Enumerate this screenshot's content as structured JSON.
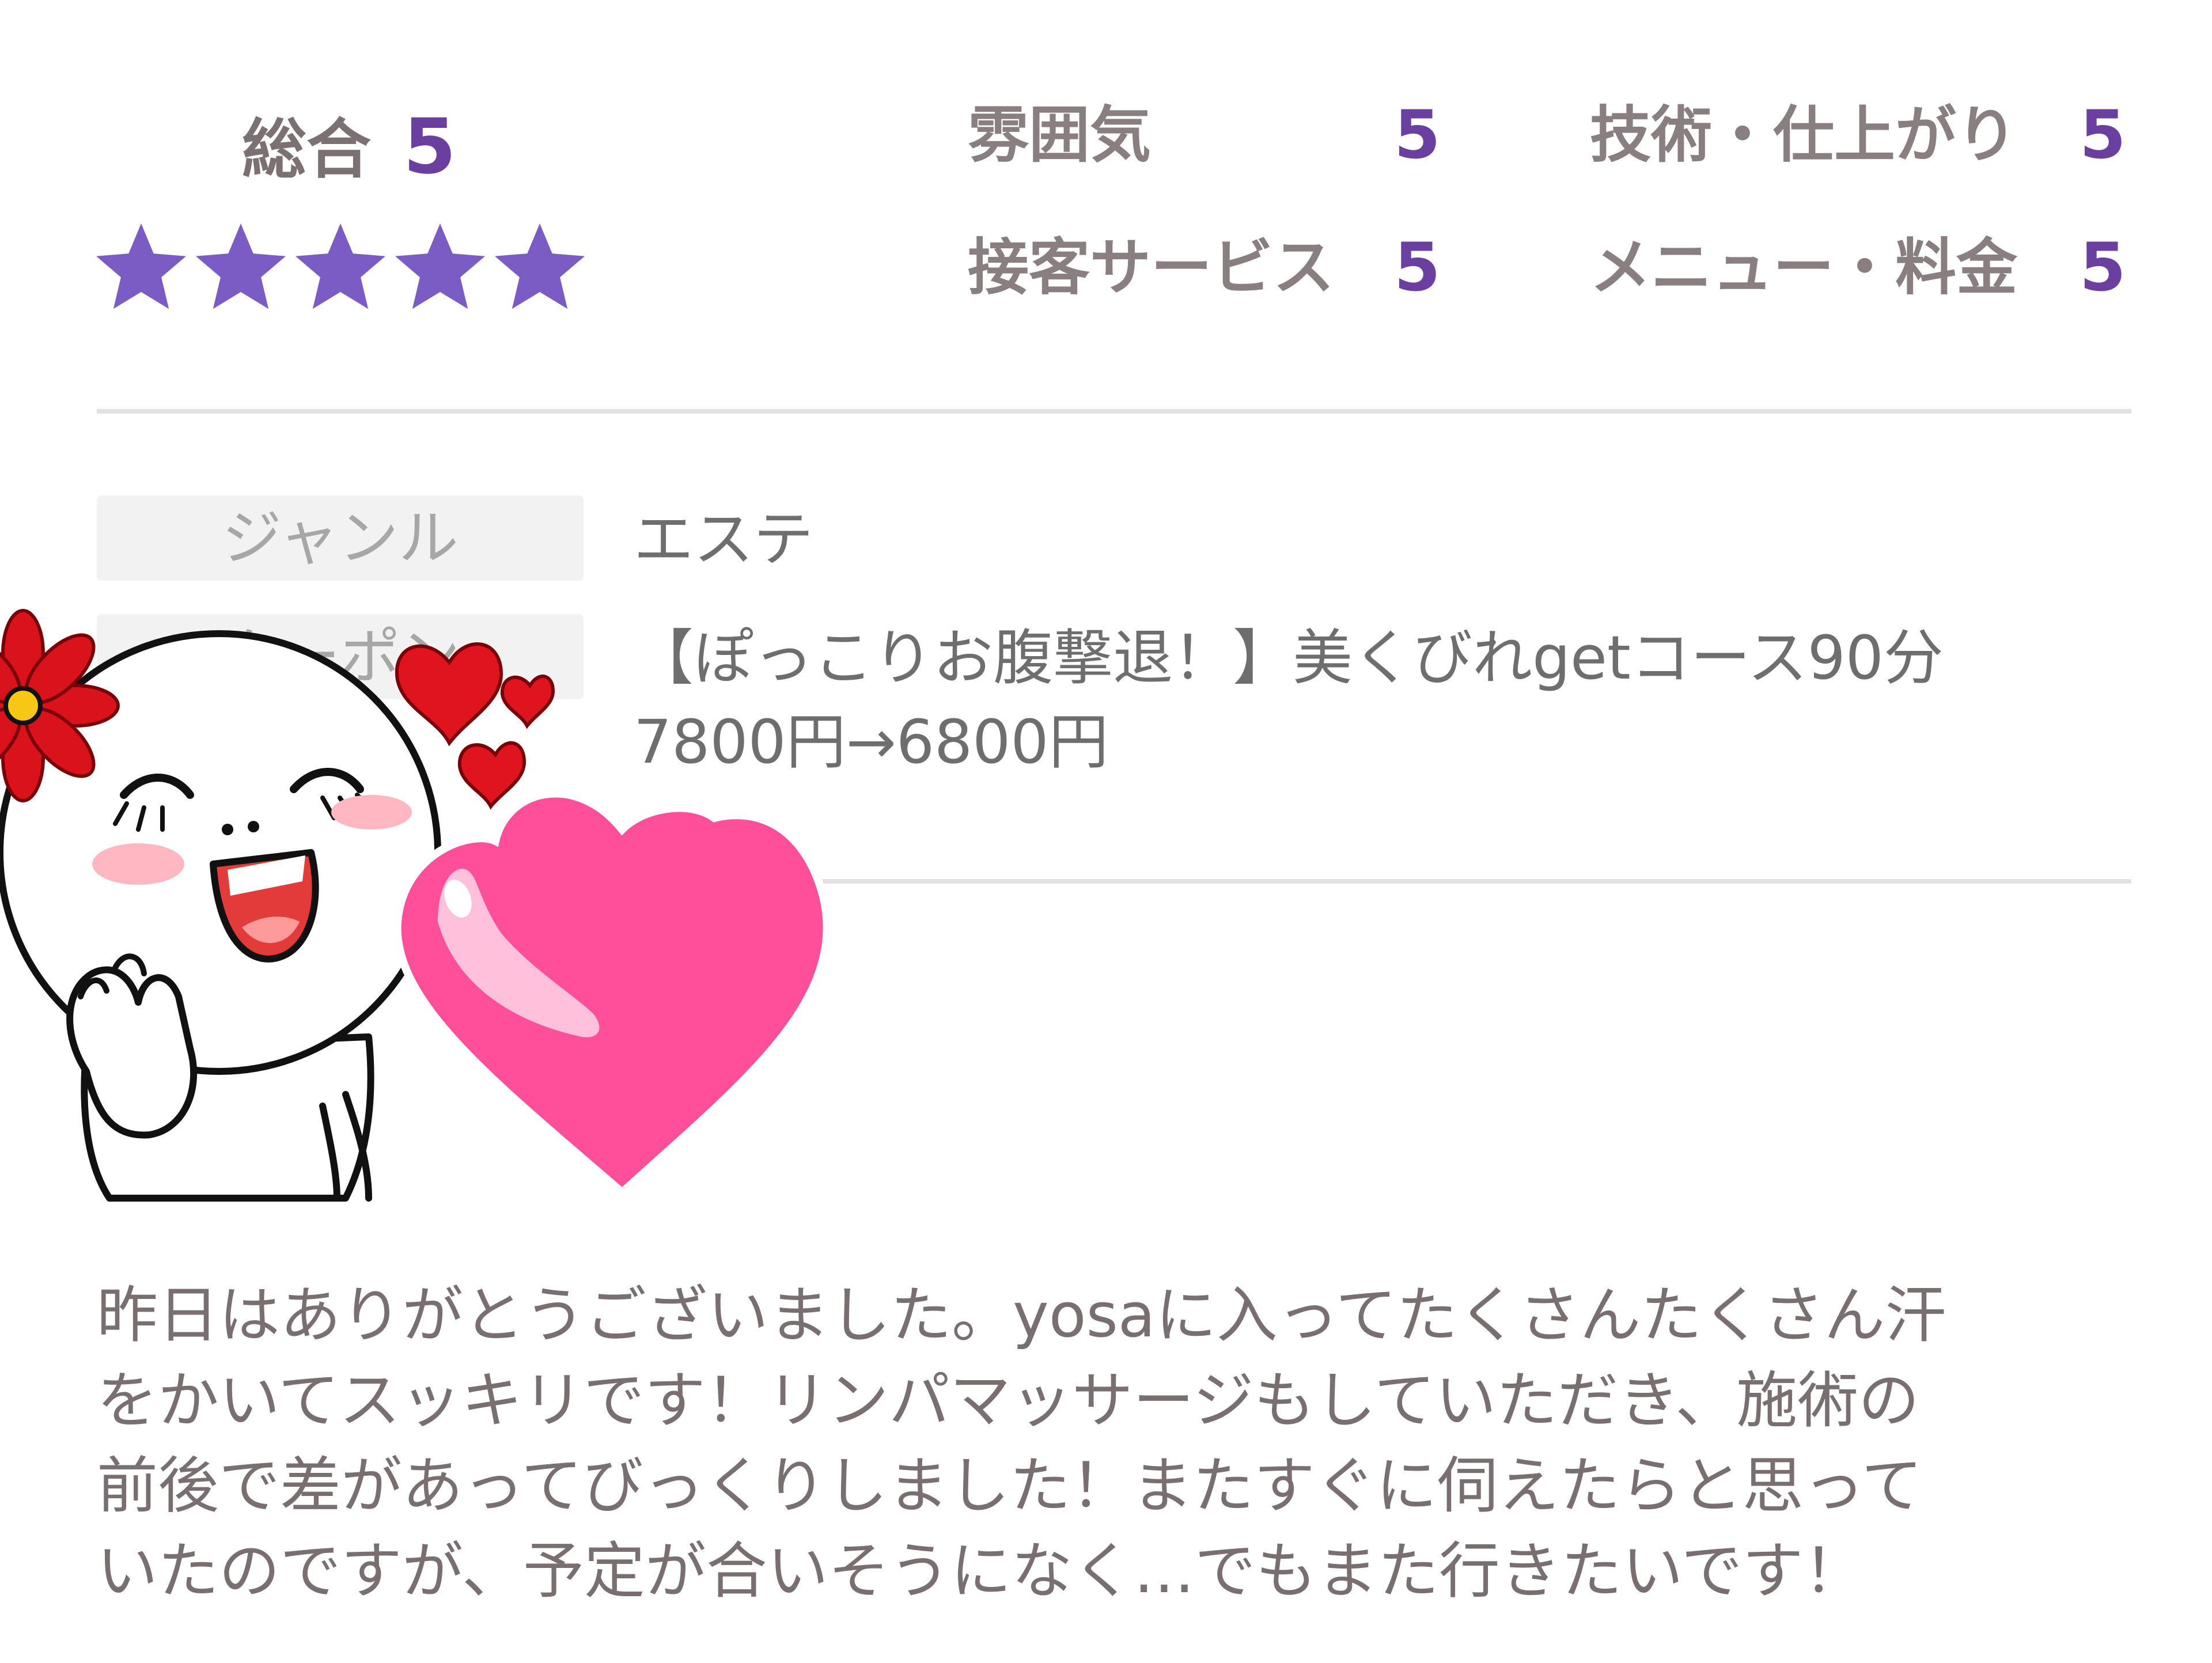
{
  "rating": {
    "overall_label": "総合",
    "overall_value": "5",
    "stars_filled": 5,
    "stars_total": 5,
    "star_color": "#7b5cc4",
    "criteria": [
      {
        "label": "雰囲気",
        "value": "5"
      },
      {
        "label": "技術・仕上がり",
        "value": "5"
      },
      {
        "label": "接客サービス",
        "value": "5"
      },
      {
        "label": "メニュー・料金",
        "value": "5"
      }
    ]
  },
  "details": {
    "genre_label": "ジャンル",
    "genre_value": "エステ",
    "coupon_label": "クーポン",
    "coupon_line1": "【ぽっこりお腹撃退！】美くびれgetコース90分",
    "coupon_line2": "7800円→6800円"
  },
  "review": {
    "text": "昨日はありがとうございました。yosaに入ってたくさんたくさん汗\nをかいてスッキリです！リンパマッサージもしていただき、施術の\n前後で差があってびっくりしました！またすぐに伺えたらと思って\nいたのですが、予定が合いそうになく…でもまた行きたいです！"
  },
  "colors": {
    "accent_purple": "#6a3fa0",
    "heart_pink": "#ff4f9a",
    "heart_red": "#e0141e",
    "flower_red": "#d9121b"
  }
}
